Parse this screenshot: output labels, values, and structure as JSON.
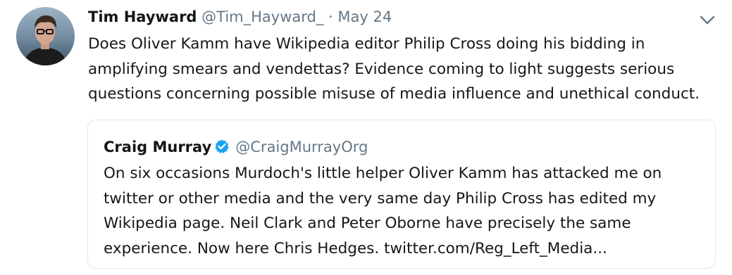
{
  "tweet": {
    "author_name": "Tim Hayward",
    "author_handle": "@Tim_Hayward_",
    "separator": "·",
    "date": "May 24",
    "text_lines": [
      "Does Oliver Kamm have Wikipedia editor Philip Cross doing his bidding in",
      "amplifying smears and vendettas? Evidence coming to light suggests serious",
      "questions concerning possible misuse of media influence and unethical conduct."
    ],
    "menu_icon": "chevron-down-icon",
    "avatar_icon": "avatar"
  },
  "quoted_tweet": {
    "author_name": "Craig Murray",
    "verified_icon": "verified-badge-icon",
    "author_handle": "@CraigMurrayOrg",
    "text_lines": [
      "On six occasions Murdoch's little helper  Oliver Kamm has attacked me on",
      "twitter or other media and the very same day Philip Cross has edited my",
      "Wikipedia page. Neil Clark and Peter Oborne have precisely the same",
      "experience. Now here Chris Hedges. twitter.com/Reg_Left_Media..."
    ]
  },
  "colors": {
    "text": "#14171a",
    "secondary_text": "#657786",
    "border": "#e1e8ed",
    "verified_blue": "#1da1f2"
  }
}
